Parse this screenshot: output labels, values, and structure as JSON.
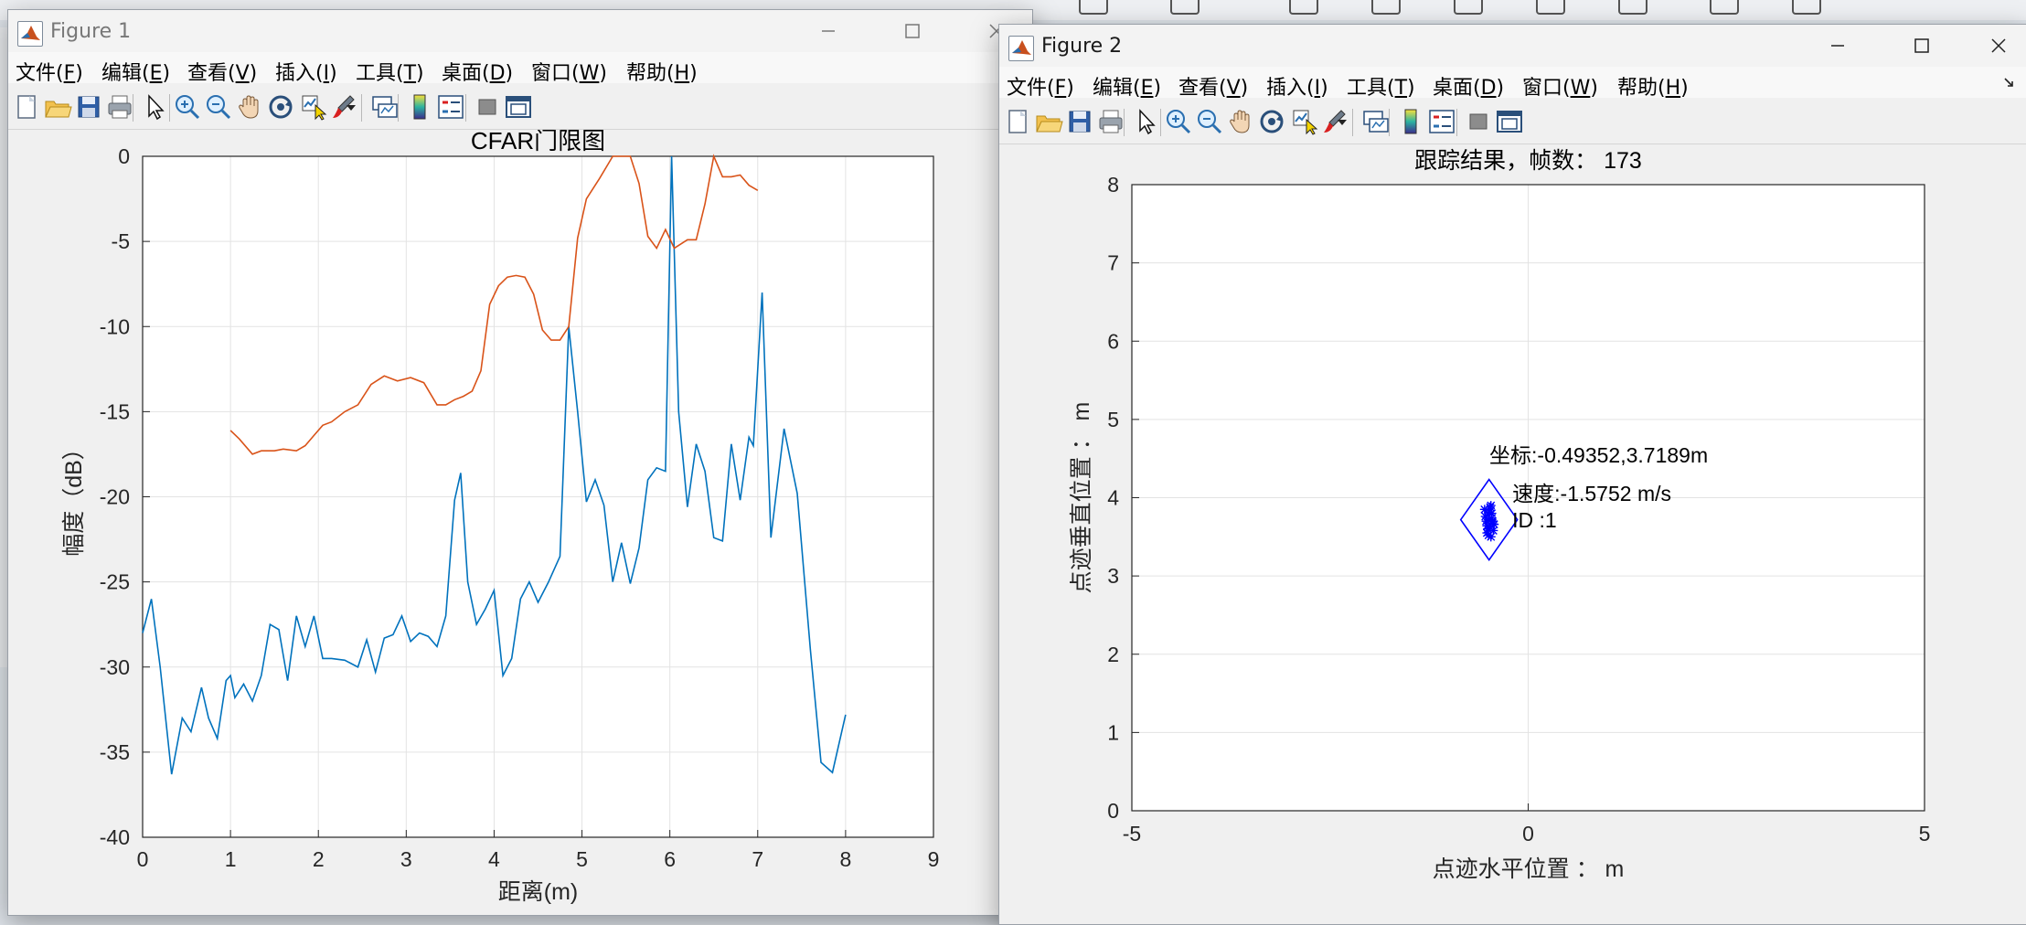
{
  "figure1": {
    "title": "Figure 1",
    "menu": [
      {
        "label": "文件(",
        "key": "F",
        "tail": ")"
      },
      {
        "label": "编辑(",
        "key": "E",
        "tail": ")"
      },
      {
        "label": "查看(",
        "key": "V",
        "tail": ")"
      },
      {
        "label": "插入(",
        "key": "I",
        "tail": ")"
      },
      {
        "label": "工具(",
        "key": "T",
        "tail": ")"
      },
      {
        "label": "桌面(",
        "key": "D",
        "tail": ")"
      },
      {
        "label": "窗口(",
        "key": "W",
        "tail": ")"
      },
      {
        "label": "帮助(",
        "key": "H",
        "tail": ")"
      }
    ]
  },
  "figure2": {
    "title": "Figure 2",
    "menu": [
      {
        "label": "文件(",
        "key": "F",
        "tail": ")"
      },
      {
        "label": "编辑(",
        "key": "E",
        "tail": ")"
      },
      {
        "label": "查看(",
        "key": "V",
        "tail": ")"
      },
      {
        "label": "插入(",
        "key": "I",
        "tail": ")"
      },
      {
        "label": "工具(",
        "key": "T",
        "tail": ")"
      },
      {
        "label": "桌面(",
        "key": "D",
        "tail": ")"
      },
      {
        "label": "窗口(",
        "key": "W",
        "tail": ")"
      },
      {
        "label": "帮助(",
        "key": "H",
        "tail": ")"
      }
    ]
  },
  "toolbar_icons": [
    "new-figure-icon",
    "open-file-icon",
    "save-icon",
    "print-icon",
    "select-arrow-icon",
    "zoom-in-icon",
    "zoom-out-icon",
    "pan-hand-icon",
    "rotate-3d-icon",
    "data-cursor-icon",
    "brush-icon",
    "link-plot-icon",
    "colorbar-icon",
    "legend-icon",
    "hide-plot-tools-icon",
    "show-plot-tools-icon"
  ],
  "colors": {
    "signal": "#0072BD",
    "threshold": "#D95319",
    "track": "#0000FF"
  },
  "chart_data": [
    {
      "type": "line",
      "title": "CFAR门限图",
      "xlabel": "距离(m)",
      "ylabel": "幅度（dB）",
      "xlim": [
        0,
        9
      ],
      "ylim": [
        -40,
        0
      ],
      "xticks": [
        "0",
        "1",
        "2",
        "3",
        "4",
        "5",
        "6",
        "7",
        "8",
        "9"
      ],
      "yticks": [
        "0",
        "-5",
        "-10",
        "-15",
        "-20",
        "-25",
        "-30",
        "-35",
        "-40"
      ],
      "grid": true,
      "series": [
        {
          "color": "#0072BD",
          "x": [
            0,
            0.1,
            0.2,
            0.33,
            0.45,
            0.55,
            0.67,
            0.75,
            0.85,
            0.95,
            1.0,
            1.05,
            1.15,
            1.25,
            1.35,
            1.45,
            1.55,
            1.65,
            1.75,
            1.85,
            1.95,
            2.05,
            2.15,
            2.3,
            2.45,
            2.55,
            2.65,
            2.75,
            2.85,
            2.95,
            3.05,
            3.15,
            3.25,
            3.35,
            3.45,
            3.55,
            3.62,
            3.7,
            3.8,
            3.9,
            4.0,
            4.1,
            4.2,
            4.3,
            4.4,
            4.5,
            4.62,
            4.75,
            4.85,
            4.95,
            5.05,
            5.15,
            5.25,
            5.35,
            5.45,
            5.55,
            5.65,
            5.75,
            5.85,
            5.95,
            6.02,
            6.1,
            6.2,
            6.3,
            6.4,
            6.5,
            6.6,
            6.7,
            6.8,
            6.9,
            6.95,
            7.05,
            7.15,
            7.3,
            7.45,
            7.6,
            7.72,
            7.85,
            8.0
          ],
          "y": [
            -28,
            -26,
            -30,
            -36.3,
            -33,
            -33.8,
            -31.2,
            -33,
            -34.2,
            -30.8,
            -30.5,
            -31.8,
            -31,
            -32,
            -30.5,
            -27.5,
            -27.8,
            -30.8,
            -27,
            -28.8,
            -27,
            -29.5,
            -29.5,
            -29.6,
            -30,
            -28.4,
            -30.3,
            -28.3,
            -28.1,
            -27,
            -28.5,
            -28,
            -28.2,
            -28.8,
            -27,
            -20.2,
            -18.6,
            -25,
            -27.5,
            -26.6,
            -25.5,
            -30.5,
            -29.5,
            -26,
            -25,
            -26.2,
            -25,
            -23.5,
            -10,
            -15,
            -20.3,
            -19,
            -20.5,
            -25,
            -22.7,
            -25.1,
            -23,
            -19,
            -18.3,
            -18.5,
            0,
            -15,
            -20.6,
            -16.9,
            -18.5,
            -22.4,
            -22.6,
            -16.9,
            -20.2,
            -16.5,
            -17,
            -8,
            -22.4,
            -16,
            -19.8,
            -29,
            -35.6,
            -36.2,
            -32.8
          ]
        },
        {
          "color": "#D95319",
          "x": [
            1.0,
            1.1,
            1.25,
            1.35,
            1.5,
            1.6,
            1.75,
            1.85,
            1.95,
            2.05,
            2.15,
            2.3,
            2.45,
            2.6,
            2.75,
            2.9,
            3.05,
            3.2,
            3.35,
            3.45,
            3.55,
            3.65,
            3.75,
            3.85,
            3.95,
            4.05,
            4.15,
            4.25,
            4.35,
            4.45,
            4.55,
            4.65,
            4.75,
            4.85,
            4.95,
            5.05,
            5.2,
            5.35,
            5.45,
            5.55,
            5.65,
            5.75,
            5.85,
            5.95,
            6.05,
            6.2,
            6.3,
            6.4,
            6.5,
            6.6,
            6.7,
            6.8,
            6.9,
            7.0
          ],
          "y": [
            -16.1,
            -16.6,
            -17.5,
            -17.3,
            -17.3,
            -17.2,
            -17.3,
            -17,
            -16.4,
            -15.8,
            -15.6,
            -15.0,
            -14.6,
            -13.4,
            -12.9,
            -13.2,
            -13.0,
            -13.3,
            -14.6,
            -14.6,
            -14.3,
            -14.1,
            -13.8,
            -12.6,
            -8.7,
            -7.6,
            -7.1,
            -7.0,
            -7.1,
            -8.1,
            -10.2,
            -10.8,
            -10.8,
            -10.0,
            -4.8,
            -2.5,
            -1.3,
            0,
            0,
            0,
            -1.6,
            -4.7,
            -5.4,
            -4.3,
            -5.4,
            -4.9,
            -4.9,
            -2.8,
            0,
            -1.2,
            -1.2,
            -1.1,
            -1.7,
            -2.0
          ]
        }
      ]
    },
    {
      "type": "scatter",
      "title": "跟踪结果，帧数：  173",
      "xlabel": "点迹水平位置 ： m",
      "ylabel": "点迹垂直位置 ： m",
      "xlim": [
        -5,
        5
      ],
      "ylim": [
        0,
        8
      ],
      "xticks": [
        "-5",
        "0",
        "5"
      ],
      "yticks": [
        "0",
        "1",
        "2",
        "3",
        "4",
        "5",
        "6",
        "7",
        "8"
      ],
      "grid": true,
      "track": {
        "x": -0.4935,
        "y": 3.7189,
        "marker": "diamond"
      },
      "points": {
        "x": [
          -0.52,
          -0.48,
          -0.45,
          -0.5,
          -0.55,
          -0.47,
          -0.43,
          -0.51,
          -0.46,
          -0.53,
          -0.49,
          -0.44,
          -0.5,
          -0.48,
          -0.52,
          -0.46,
          -0.5,
          -0.47,
          -0.54,
          -0.45
        ],
        "y": [
          3.55,
          3.62,
          3.7,
          3.78,
          3.85,
          3.9,
          3.66,
          3.6,
          3.74,
          3.7,
          3.82,
          3.58,
          3.52,
          3.88,
          3.64,
          3.8,
          3.72,
          3.5,
          3.76,
          3.68
        ]
      },
      "annotations": [
        {
          "text": "坐标:-0.49352,3.7189m",
          "x": -0.49,
          "y": 4.45
        },
        {
          "text": "速度:-1.5752  m/s",
          "x": -0.2,
          "y": 3.96
        },
        {
          "text": "ID :1",
          "x": -0.2,
          "y": 3.62
        }
      ]
    }
  ]
}
